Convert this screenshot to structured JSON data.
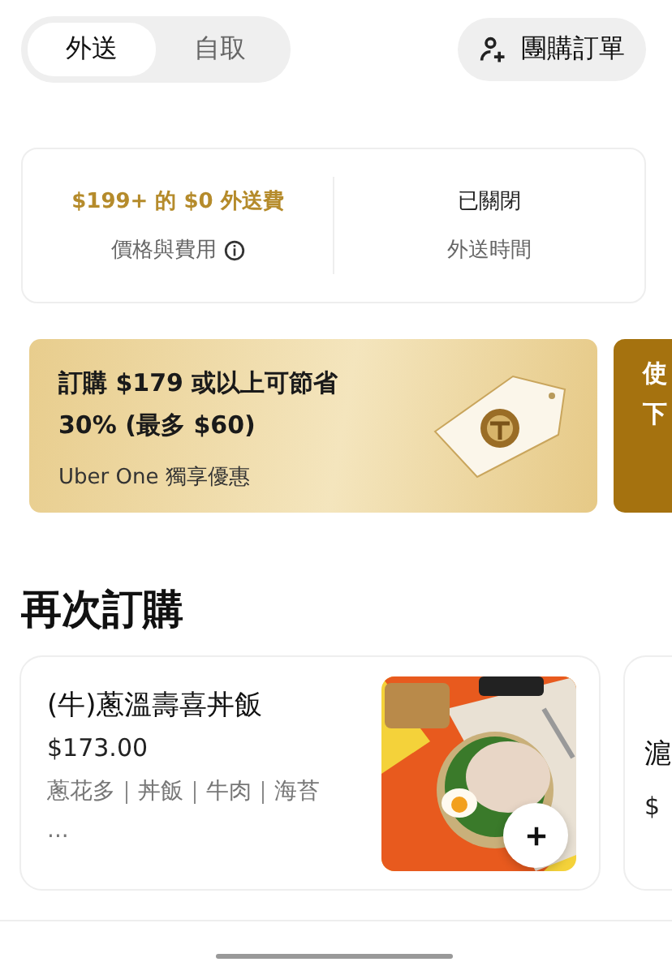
{
  "mode_tabs": [
    {
      "label": "外送",
      "selected": true
    },
    {
      "label": "自取",
      "selected": false
    }
  ],
  "group_order_button": {
    "label": "團購訂單"
  },
  "info_card": {
    "fee": {
      "value": "$199+ 的 $0 外送費",
      "label": "價格與費用"
    },
    "delivery": {
      "value": "已關閉",
      "label": "外送時間"
    }
  },
  "promos": [
    {
      "kind": "offer",
      "title": "訂購 $179 或以上可節省 30% (最多 $60)",
      "subtitle": "Uber One 獨享優惠"
    },
    {
      "kind": "partial",
      "lines": [
        "使",
        "下"
      ]
    }
  ],
  "section_title": "再次訂購",
  "reorder_items": [
    {
      "kind": "full",
      "name": "(牛)蔥溫壽喜丼飯",
      "price": "$173.00",
      "tags": "蔥花多｜丼飯｜牛肉｜海苔 ..."
    },
    {
      "kind": "partial",
      "name": "滬",
      "price": "$"
    }
  ]
}
